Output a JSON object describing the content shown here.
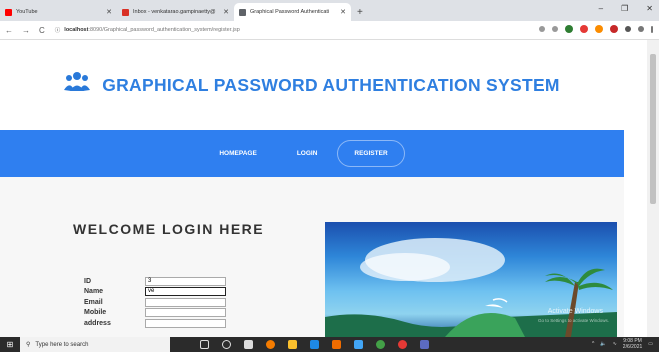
{
  "browser": {
    "tabs": [
      {
        "title": "YouTube",
        "color": "#ff0000",
        "active": false
      },
      {
        "title": "Inbox - venkatarao.gampinaetty@",
        "color": "#d93025",
        "active": false
      },
      {
        "title": "Graphical Password Authenticati",
        "color": "#5f6368",
        "active": true
      }
    ],
    "new_tab": "+",
    "url_host": "localhost",
    "url_path": ":8090/Graphical_password_authentication_system/register.jsp",
    "win_controls": [
      "–",
      "❐",
      "✕"
    ]
  },
  "site": {
    "title": "GRAPHICAL PASSWORD AUTHENTICATION SYSTEM",
    "nav": [
      "HOMEPAGE",
      "LOGIN",
      "REGISTER"
    ]
  },
  "login": {
    "heading": "WELCOME LOGIN HERE",
    "fields": [
      {
        "label": "ID",
        "value": "3"
      },
      {
        "label": "Name",
        "value": "ve"
      },
      {
        "label": "Email",
        "value": ""
      },
      {
        "label": "Mobile",
        "value": ""
      },
      {
        "label": "address",
        "value": ""
      }
    ]
  },
  "hero": {
    "watermark": "Activate Windows",
    "watermark_sub": "Go to Settings to activate Windows."
  },
  "taskbar": {
    "search_placeholder": "Type here to search",
    "time": "9:08 PM",
    "date": "2/6/2021"
  },
  "colors": {
    "accent": "#2f7ff0",
    "title": "#2f7fe0"
  }
}
